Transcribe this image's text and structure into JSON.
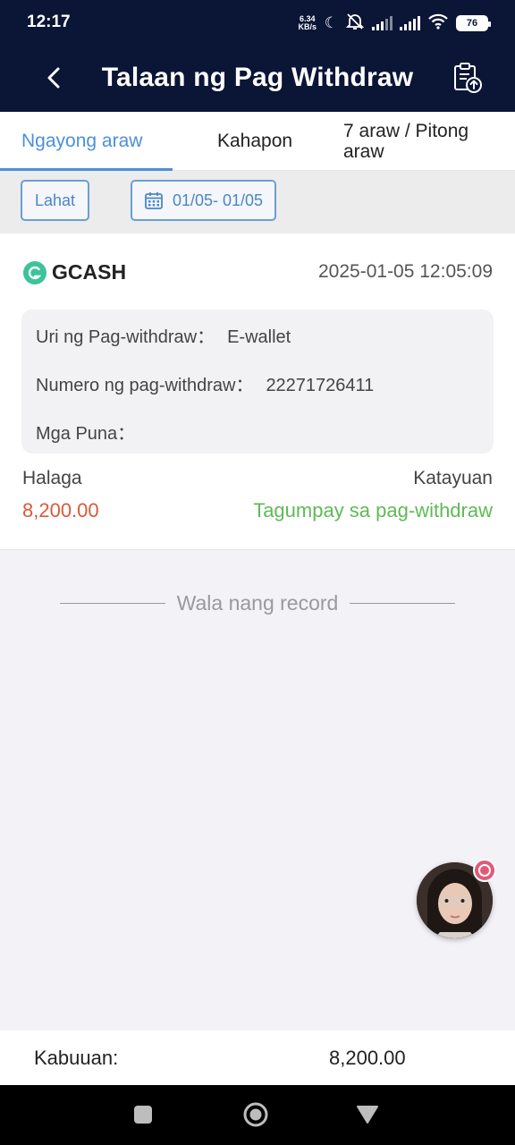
{
  "status_bar": {
    "time": "12:17",
    "net_speed_value": "6.34",
    "net_speed_unit": "KB/s",
    "battery": "76"
  },
  "header": {
    "title": "Talaan ng Pag Withdraw"
  },
  "tabs": [
    {
      "label": "Ngayong araw",
      "active": true
    },
    {
      "label": "Kahapon",
      "active": false
    },
    {
      "label": "7 araw / Pitong araw",
      "active": false
    }
  ],
  "filters": {
    "all_label": "Lahat",
    "date_range": "01/05- 01/05"
  },
  "record": {
    "provider": "GCASH",
    "datetime": "2025-01-05 12:05:09",
    "type_label": "Uri ng Pag-withdraw：",
    "type_value": "E-wallet",
    "number_label": "Numero ng pag-withdraw：",
    "number_value": "22271726411",
    "remarks_label": "Mga Puna：",
    "remarks_value": "",
    "amount_label": "Halaga",
    "amount_value": "8,200.00",
    "status_label": "Katayuan",
    "status_value": "Tagumpay sa pag-withdraw"
  },
  "list_end_text": "Wala nang record",
  "total": {
    "label": "Kabuuan:",
    "value": "8,200.00"
  },
  "colors": {
    "header_bg": "#0b1536",
    "accent": "#4a90d9",
    "amount": "#d85a3a",
    "success": "#5fba55"
  }
}
